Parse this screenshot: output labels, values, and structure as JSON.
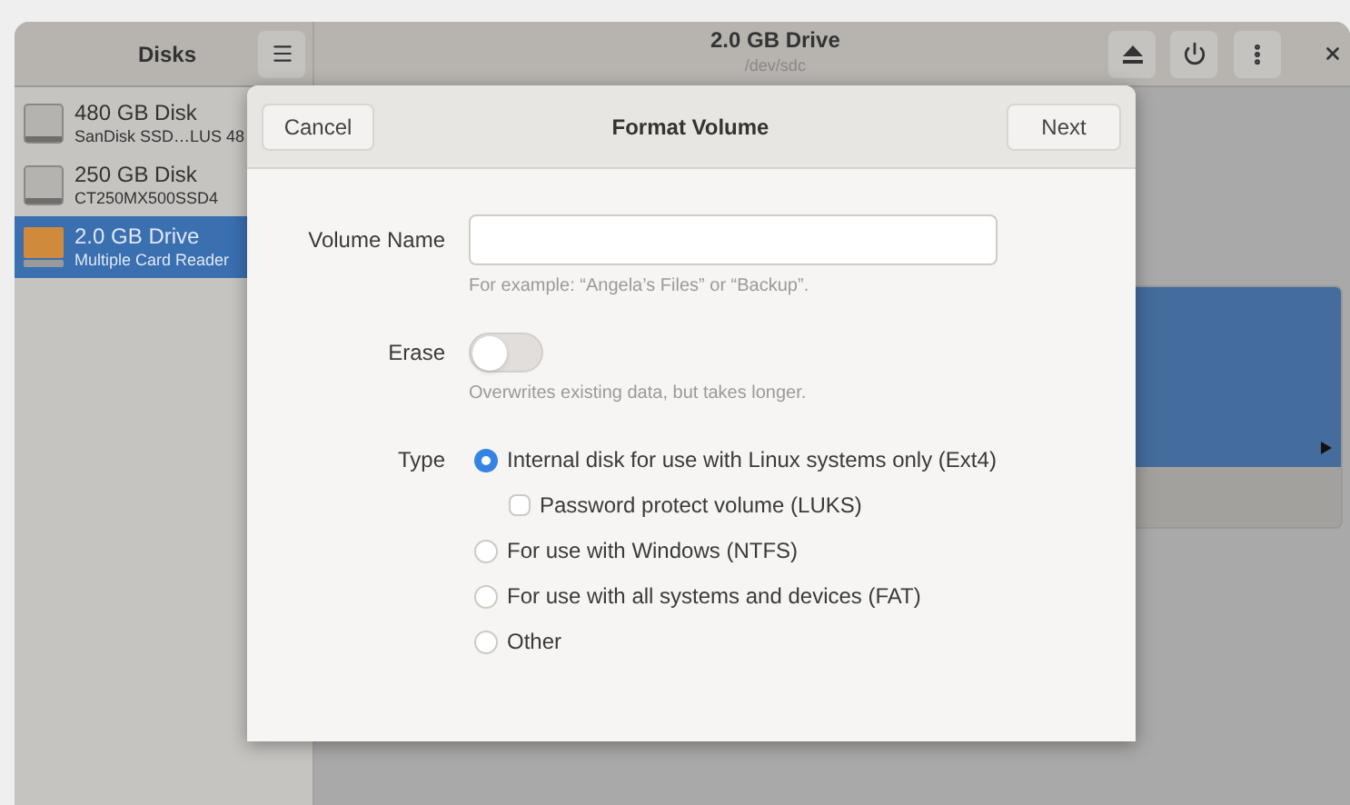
{
  "window": {
    "title": "Disks"
  },
  "drive": {
    "title": "2.0 GB Drive",
    "subtitle": "/dev/sdc"
  },
  "disks": [
    {
      "name": "480 GB Disk",
      "model": "SanDisk SSD…LUS 48",
      "kind": "drive",
      "selected": false
    },
    {
      "name": "250 GB Disk",
      "model": "CT250MX500SSD4",
      "kind": "drive",
      "selected": false
    },
    {
      "name": "2.0 GB Drive",
      "model": "Multiple Card  Reader",
      "kind": "card",
      "selected": true
    }
  ],
  "dialog": {
    "title": "Format Volume",
    "cancel": "Cancel",
    "next": "Next",
    "volume_name": {
      "label": "Volume Name",
      "hint": "For example: “Angela’s Files” or “Backup”."
    },
    "erase": {
      "label": "Erase",
      "on": false,
      "hint": "Overwrites existing data, but takes longer."
    },
    "type": {
      "label": "Type",
      "options": [
        {
          "kind": "radio",
          "label": "Internal disk for use with Linux systems only (Ext4)",
          "selected": true
        },
        {
          "kind": "checkbox",
          "label": "Password protect volume (LUKS)",
          "checked": false
        },
        {
          "kind": "radio",
          "label": "For use with Windows (NTFS)",
          "selected": false
        },
        {
          "kind": "radio",
          "label": "For use with all systems and devices (FAT)",
          "selected": false
        },
        {
          "kind": "radio",
          "label": "Other",
          "selected": false
        }
      ]
    }
  }
}
